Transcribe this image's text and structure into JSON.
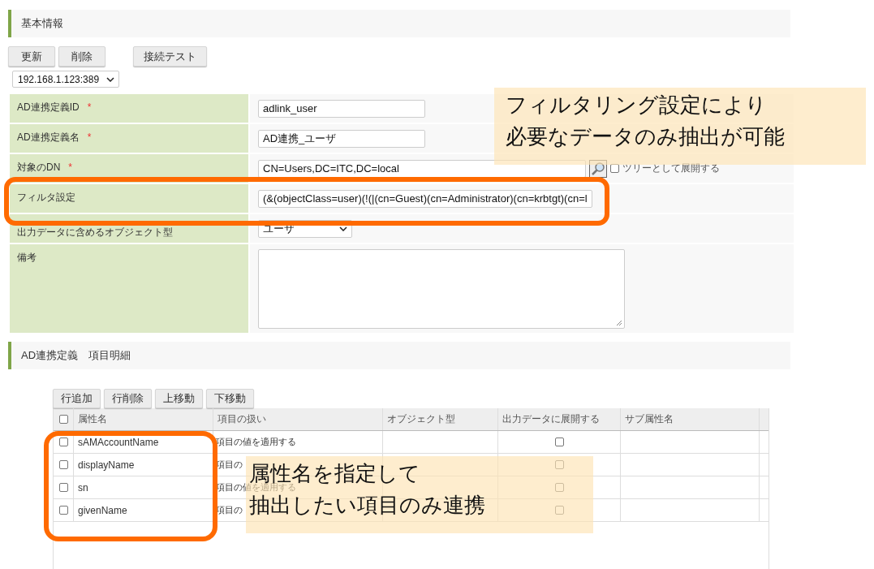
{
  "basic_info": {
    "title": "基本情報",
    "buttons": [
      "更新",
      "削除",
      "接続テスト"
    ],
    "server_select": "192.168.1.123:389",
    "fields": [
      {
        "kind": "text",
        "label": "AD連携定義ID",
        "required_mark": "*",
        "value": "adlink_user"
      },
      {
        "kind": "text",
        "label": "AD連携定義名",
        "required_mark": "*",
        "value": "AD連携_ユーザ"
      },
      {
        "kind": "dn",
        "label": "対象のDN",
        "required_mark": "*",
        "value": "CN=Users,DC=ITC,DC=local",
        "tree_label": "ツリーとして展開する",
        "tree_checked": false
      },
      {
        "kind": "wide",
        "label": "フィルタ設定",
        "value": "(&(objectClass=user)(!(|(cn=Guest)(cn=Administrator)(cn=krbtgt)(cn=l"
      },
      {
        "kind": "select",
        "label": "出力データに含めるオブジェクト型",
        "value": "ユーザ"
      },
      {
        "kind": "textarea",
        "label": "備考"
      }
    ]
  },
  "detail": {
    "title": "AD連携定義　項目明細",
    "buttons": [
      "行追加",
      "行削除",
      "上移動",
      "下移動"
    ],
    "select_all_checked": false,
    "columns": [
      "属性名",
      "項目の扱い",
      "オブジェクト型",
      "出力データに展開する",
      "サブ属性名"
    ],
    "rows": [
      {
        "checked": false,
        "name": "sAMAccountName",
        "handling": "項目の値を適用する",
        "expand": false
      },
      {
        "checked": false,
        "name": "displayName",
        "handling": "項目の",
        "expand": false
      },
      {
        "checked": false,
        "name": "sn",
        "handling": "項目の値を適用する",
        "expand": false
      },
      {
        "checked": false,
        "name": "givenName",
        "handling": "項目の",
        "expand": false
      }
    ]
  },
  "callouts": [
    {
      "lines": [
        "フィルタリング設定により",
        "必要なデータのみ抽出が可能"
      ]
    },
    {
      "lines": [
        "属性名を指定して",
        "抽出したい項目のみ連携"
      ]
    }
  ]
}
